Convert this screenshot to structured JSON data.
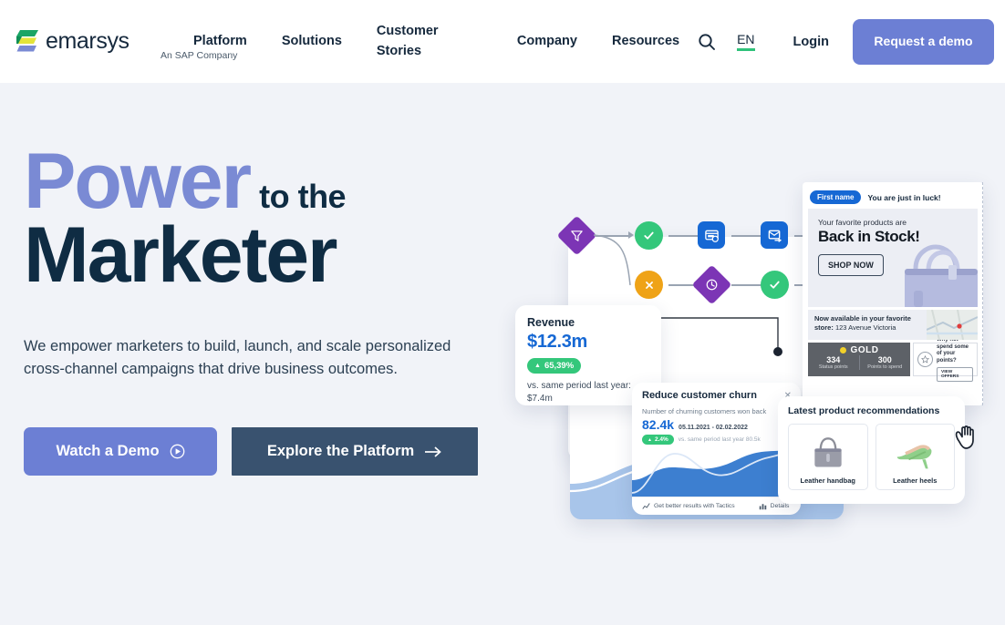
{
  "brand": {
    "name": "emarsys",
    "tagline": "An SAP Company",
    "logo_icon": "emarsys-chevron-logo",
    "colors": {
      "green": "#2fc27a",
      "yellow": "#e8e83a",
      "blue": "#7a8ad4",
      "navy": "#0f2c43",
      "periwinkle": "#6c7fd4",
      "slate": "#39526f",
      "accent_blue": "#1668d4"
    }
  },
  "header": {
    "nav": [
      {
        "label": "Platform",
        "name": "nav-platform"
      },
      {
        "label": "Solutions",
        "name": "nav-solutions"
      },
      {
        "label": "Customer Stories",
        "name": "nav-customer-stories"
      },
      {
        "label": "Company",
        "name": "nav-company"
      },
      {
        "label": "Resources",
        "name": "nav-resources"
      }
    ],
    "search_icon": "search-icon",
    "language": "EN",
    "login": "Login",
    "demo_button": "Request a demo"
  },
  "hero": {
    "headline_accent": "Power",
    "headline_mid": "to the",
    "headline_bold": "Marketer",
    "lede": "We empower marketers to build, launch, and scale personalized cross-channel campaigns that drive business outcomes.",
    "cta_primary": "Watch a Demo",
    "cta_primary_icon": "play-circle-icon",
    "cta_secondary": "Explore the Platform",
    "cta_secondary_icon": "arrow-right-icon"
  },
  "art": {
    "workflow": {
      "nodes": [
        {
          "name": "filter-node",
          "icon": "funnel-icon",
          "shape": "diamond",
          "color": "#7c35b5"
        },
        {
          "name": "success-node-1",
          "icon": "check-icon",
          "shape": "circle",
          "color": "#34c77b"
        },
        {
          "name": "ad-node",
          "icon": "ad-window-icon",
          "shape": "square",
          "color": "#1668d4"
        },
        {
          "name": "email-node",
          "icon": "email-send-icon",
          "shape": "square",
          "color": "#1668d4"
        },
        {
          "name": "fail-node",
          "icon": "close-icon",
          "shape": "circle",
          "color": "#efa317"
        },
        {
          "name": "wait-node",
          "icon": "clock-icon",
          "shape": "diamond",
          "color": "#7c35b5"
        },
        {
          "name": "success-node-2",
          "icon": "check-icon",
          "shape": "circle",
          "color": "#34c77b"
        }
      ]
    },
    "revenue_card": {
      "title": "Revenue",
      "value": "$12.3m",
      "delta": "65,39%",
      "delta_caret": "▲",
      "note": "vs. same period last year: $7.4m"
    },
    "churn_card": {
      "title": "Reduce customer churn",
      "close_icon": "close-icon",
      "subtitle": "Number of churning customers won back",
      "value": "82.4k",
      "date_range": "05.11.2021 - 02.02.2022",
      "delta": "2.4%",
      "delta_caret": "▲",
      "comparison": "vs. same period last year 80.5k",
      "footer_tactics": "Get better results with Tactics",
      "footer_tactics_icon": "trend-up-icon",
      "footer_details": "Details",
      "footer_details_icon": "bar-chart-icon"
    },
    "email_preview": {
      "personalization_tag": "First name",
      "greeting": "You are just in luck!",
      "hero_sub": "Your favorite products are",
      "hero_headline": "Back in Stock!",
      "hero_button": "SHOP NOW",
      "hero_image": "handbag-illustration",
      "store_prefix": "Now available in your favorite store:",
      "store_address": "123 Avenue Victoria",
      "map_icon": "map-thumbnail",
      "loyalty": {
        "tier": "GOLD",
        "tier_dot": "gold-dot-icon",
        "status_points_value": "334",
        "status_points_label": "Status points",
        "spend_points_value": "300",
        "spend_points_label": "Points to spend",
        "offer_icon": "star-badge-icon",
        "offer_text": "Why not spend some of your points?",
        "offer_button": "VIEW OFFERS"
      }
    },
    "recommendations": {
      "title": "Latest product recommendations",
      "items": [
        {
          "label": "Leather handbag",
          "image": "handbag-thumb"
        },
        {
          "label": "Leather heels",
          "image": "heels-thumb"
        }
      ],
      "cursor_icon": "hand-cursor-icon"
    }
  }
}
